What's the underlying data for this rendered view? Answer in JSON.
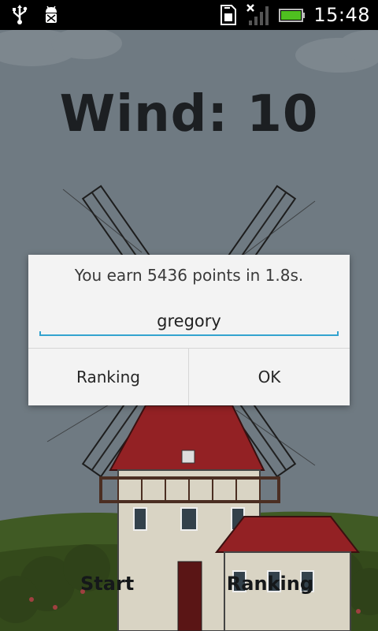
{
  "status_bar": {
    "time": "15:48",
    "icons": [
      "usb-icon",
      "android-debug-icon",
      "sim-card-icon",
      "no-signal-icon",
      "battery-icon"
    ],
    "battery_color": "#4fc020"
  },
  "game": {
    "wind_label": "Wind: 10",
    "buttons": {
      "start_label": "Start",
      "ranking_label": "Ranking"
    }
  },
  "dialog": {
    "message": "You earn 5436 points in 1.8s.",
    "name_value": "gregory",
    "ranking_button": "Ranking",
    "ok_button": "OK",
    "accent_color": "#33a3cf"
  }
}
